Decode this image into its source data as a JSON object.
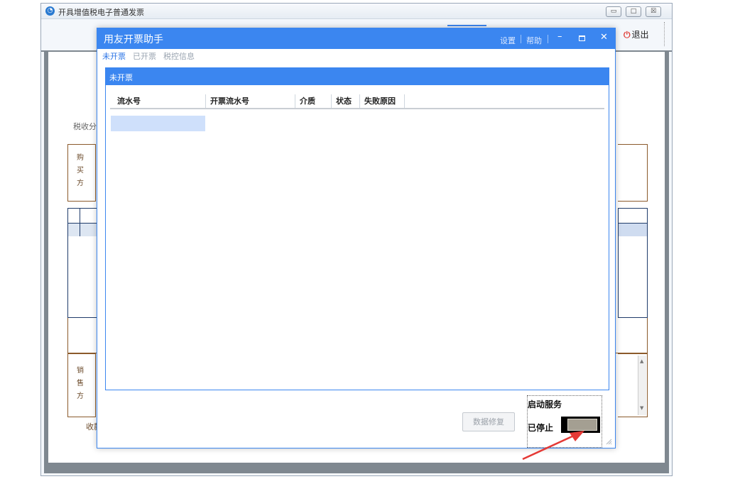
{
  "outer_window": {
    "title": "开具增值税电子普通发票",
    "exit_label": "退出",
    "min_glyph": "▭",
    "max_glyph": "□",
    "close_glyph": "☒"
  },
  "invoice": {
    "tax_class_label": "税收分类",
    "buyer_chars": [
      "购",
      "买",
      "方"
    ],
    "seller_chars": [
      "销",
      "售",
      "方"
    ],
    "payee_label": "收款"
  },
  "dialog": {
    "title": "用友开票助手",
    "settings_label": "设置",
    "help_label": "帮助",
    "tabs": [
      {
        "label": "未开票",
        "active": true
      },
      {
        "label": "已开票",
        "active": false
      },
      {
        "label": "税控信息",
        "active": false
      }
    ],
    "panel_title": "未开票",
    "columns": [
      "流水号",
      "开票流水号",
      "介质",
      "状态",
      "失败原因"
    ],
    "repair_button": "数据修复",
    "service": {
      "label": "启动服务",
      "status": "已停止"
    }
  },
  "colors": {
    "accent": "#3b86f0",
    "arrow": "#e53935",
    "invoice_border": "#8b5a2b"
  }
}
